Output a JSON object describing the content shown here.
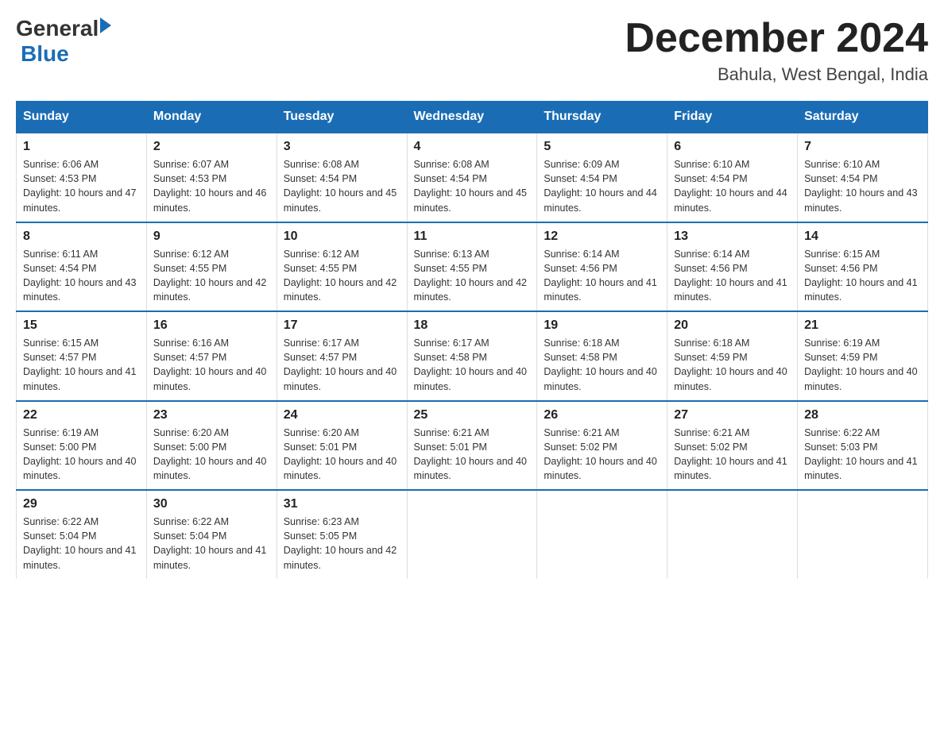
{
  "header": {
    "logo_general": "General",
    "logo_blue": "Blue",
    "month_title": "December 2024",
    "location": "Bahula, West Bengal, India"
  },
  "days_of_week": [
    "Sunday",
    "Monday",
    "Tuesday",
    "Wednesday",
    "Thursday",
    "Friday",
    "Saturday"
  ],
  "weeks": [
    [
      {
        "day": "1",
        "sunrise": "6:06 AM",
        "sunset": "4:53 PM",
        "daylight": "10 hours and 47 minutes."
      },
      {
        "day": "2",
        "sunrise": "6:07 AM",
        "sunset": "4:53 PM",
        "daylight": "10 hours and 46 minutes."
      },
      {
        "day": "3",
        "sunrise": "6:08 AM",
        "sunset": "4:54 PM",
        "daylight": "10 hours and 45 minutes."
      },
      {
        "day": "4",
        "sunrise": "6:08 AM",
        "sunset": "4:54 PM",
        "daylight": "10 hours and 45 minutes."
      },
      {
        "day": "5",
        "sunrise": "6:09 AM",
        "sunset": "4:54 PM",
        "daylight": "10 hours and 44 minutes."
      },
      {
        "day": "6",
        "sunrise": "6:10 AM",
        "sunset": "4:54 PM",
        "daylight": "10 hours and 44 minutes."
      },
      {
        "day": "7",
        "sunrise": "6:10 AM",
        "sunset": "4:54 PM",
        "daylight": "10 hours and 43 minutes."
      }
    ],
    [
      {
        "day": "8",
        "sunrise": "6:11 AM",
        "sunset": "4:54 PM",
        "daylight": "10 hours and 43 minutes."
      },
      {
        "day": "9",
        "sunrise": "6:12 AM",
        "sunset": "4:55 PM",
        "daylight": "10 hours and 42 minutes."
      },
      {
        "day": "10",
        "sunrise": "6:12 AM",
        "sunset": "4:55 PM",
        "daylight": "10 hours and 42 minutes."
      },
      {
        "day": "11",
        "sunrise": "6:13 AM",
        "sunset": "4:55 PM",
        "daylight": "10 hours and 42 minutes."
      },
      {
        "day": "12",
        "sunrise": "6:14 AM",
        "sunset": "4:56 PM",
        "daylight": "10 hours and 41 minutes."
      },
      {
        "day": "13",
        "sunrise": "6:14 AM",
        "sunset": "4:56 PM",
        "daylight": "10 hours and 41 minutes."
      },
      {
        "day": "14",
        "sunrise": "6:15 AM",
        "sunset": "4:56 PM",
        "daylight": "10 hours and 41 minutes."
      }
    ],
    [
      {
        "day": "15",
        "sunrise": "6:15 AM",
        "sunset": "4:57 PM",
        "daylight": "10 hours and 41 minutes."
      },
      {
        "day": "16",
        "sunrise": "6:16 AM",
        "sunset": "4:57 PM",
        "daylight": "10 hours and 40 minutes."
      },
      {
        "day": "17",
        "sunrise": "6:17 AM",
        "sunset": "4:57 PM",
        "daylight": "10 hours and 40 minutes."
      },
      {
        "day": "18",
        "sunrise": "6:17 AM",
        "sunset": "4:58 PM",
        "daylight": "10 hours and 40 minutes."
      },
      {
        "day": "19",
        "sunrise": "6:18 AM",
        "sunset": "4:58 PM",
        "daylight": "10 hours and 40 minutes."
      },
      {
        "day": "20",
        "sunrise": "6:18 AM",
        "sunset": "4:59 PM",
        "daylight": "10 hours and 40 minutes."
      },
      {
        "day": "21",
        "sunrise": "6:19 AM",
        "sunset": "4:59 PM",
        "daylight": "10 hours and 40 minutes."
      }
    ],
    [
      {
        "day": "22",
        "sunrise": "6:19 AM",
        "sunset": "5:00 PM",
        "daylight": "10 hours and 40 minutes."
      },
      {
        "day": "23",
        "sunrise": "6:20 AM",
        "sunset": "5:00 PM",
        "daylight": "10 hours and 40 minutes."
      },
      {
        "day": "24",
        "sunrise": "6:20 AM",
        "sunset": "5:01 PM",
        "daylight": "10 hours and 40 minutes."
      },
      {
        "day": "25",
        "sunrise": "6:21 AM",
        "sunset": "5:01 PM",
        "daylight": "10 hours and 40 minutes."
      },
      {
        "day": "26",
        "sunrise": "6:21 AM",
        "sunset": "5:02 PM",
        "daylight": "10 hours and 40 minutes."
      },
      {
        "day": "27",
        "sunrise": "6:21 AM",
        "sunset": "5:02 PM",
        "daylight": "10 hours and 41 minutes."
      },
      {
        "day": "28",
        "sunrise": "6:22 AM",
        "sunset": "5:03 PM",
        "daylight": "10 hours and 41 minutes."
      }
    ],
    [
      {
        "day": "29",
        "sunrise": "6:22 AM",
        "sunset": "5:04 PM",
        "daylight": "10 hours and 41 minutes."
      },
      {
        "day": "30",
        "sunrise": "6:22 AM",
        "sunset": "5:04 PM",
        "daylight": "10 hours and 41 minutes."
      },
      {
        "day": "31",
        "sunrise": "6:23 AM",
        "sunset": "5:05 PM",
        "daylight": "10 hours and 42 minutes."
      },
      null,
      null,
      null,
      null
    ]
  ]
}
